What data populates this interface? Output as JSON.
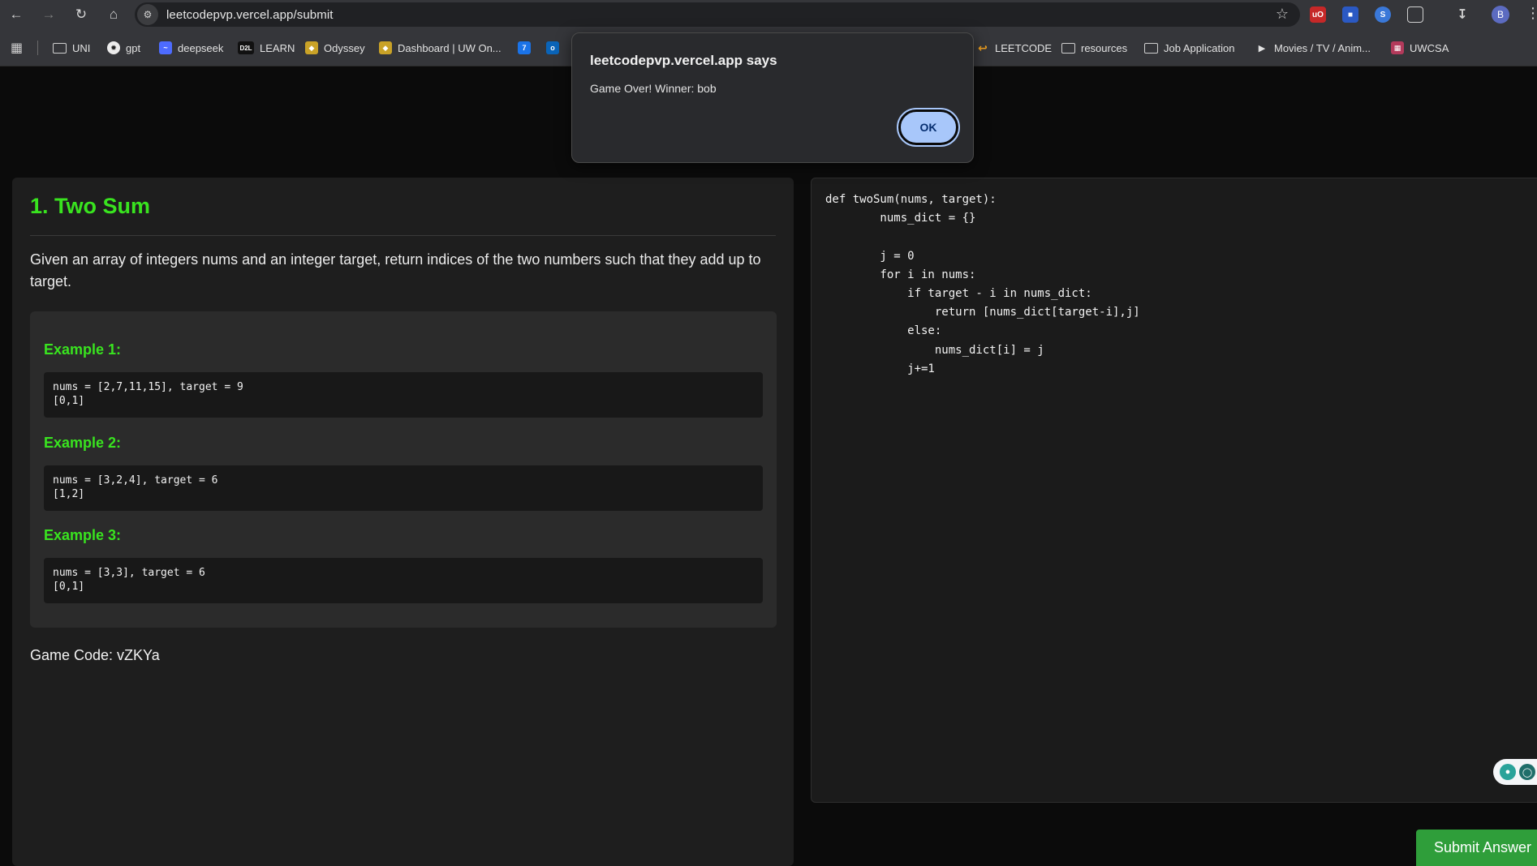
{
  "browser": {
    "url": "leetcodepvp.vercel.app/submit",
    "bookmarks": [
      "UNI",
      "gpt",
      "deepseek",
      "LEARN",
      "Odyssey",
      "Dashboard | UW On...",
      "LEETCODE",
      "resources",
      "Job Application",
      "Movies / TV / Anim...",
      "UWCSA"
    ],
    "profile_initial": "B",
    "ext_labels": {
      "ublock": "uO",
      "calendar": "7",
      "outlook": "o",
      "d2l": "D2L"
    }
  },
  "dialog": {
    "title": "leetcodepvp.vercel.app says",
    "message": "Game Over! Winner: bob",
    "ok_label": "OK"
  },
  "problem": {
    "title": "1. Two Sum",
    "description": "Given an array of integers nums and an integer target, return indices of the two numbers such that they add up to target.",
    "examples": [
      {
        "label": "Example 1:",
        "input": "nums = [2,7,11,15], target = 9",
        "output": "[0,1]"
      },
      {
        "label": "Example 2:",
        "input": "nums = [3,2,4], target = 6",
        "output": "[1,2]"
      },
      {
        "label": "Example 3:",
        "input": "nums = [3,3], target = 6",
        "output": "[0,1]"
      }
    ],
    "game_code": "Game Code: vZKYa"
  },
  "editor": {
    "lines": [
      "def twoSum(nums, target):",
      "        nums_dict = {}",
      "",
      "        j = 0",
      "        for i in nums:",
      "            if target - i in nums_dict:",
      "                return [nums_dict[target-i],j]",
      "            else:",
      "                nums_dict[i] = j",
      "            j+=1"
    ]
  },
  "submit_label": "Submit Answer",
  "colors": {
    "accent": "#39e41f",
    "submit": "#2f9e3a",
    "dialog_button": "#a8c7fa"
  }
}
